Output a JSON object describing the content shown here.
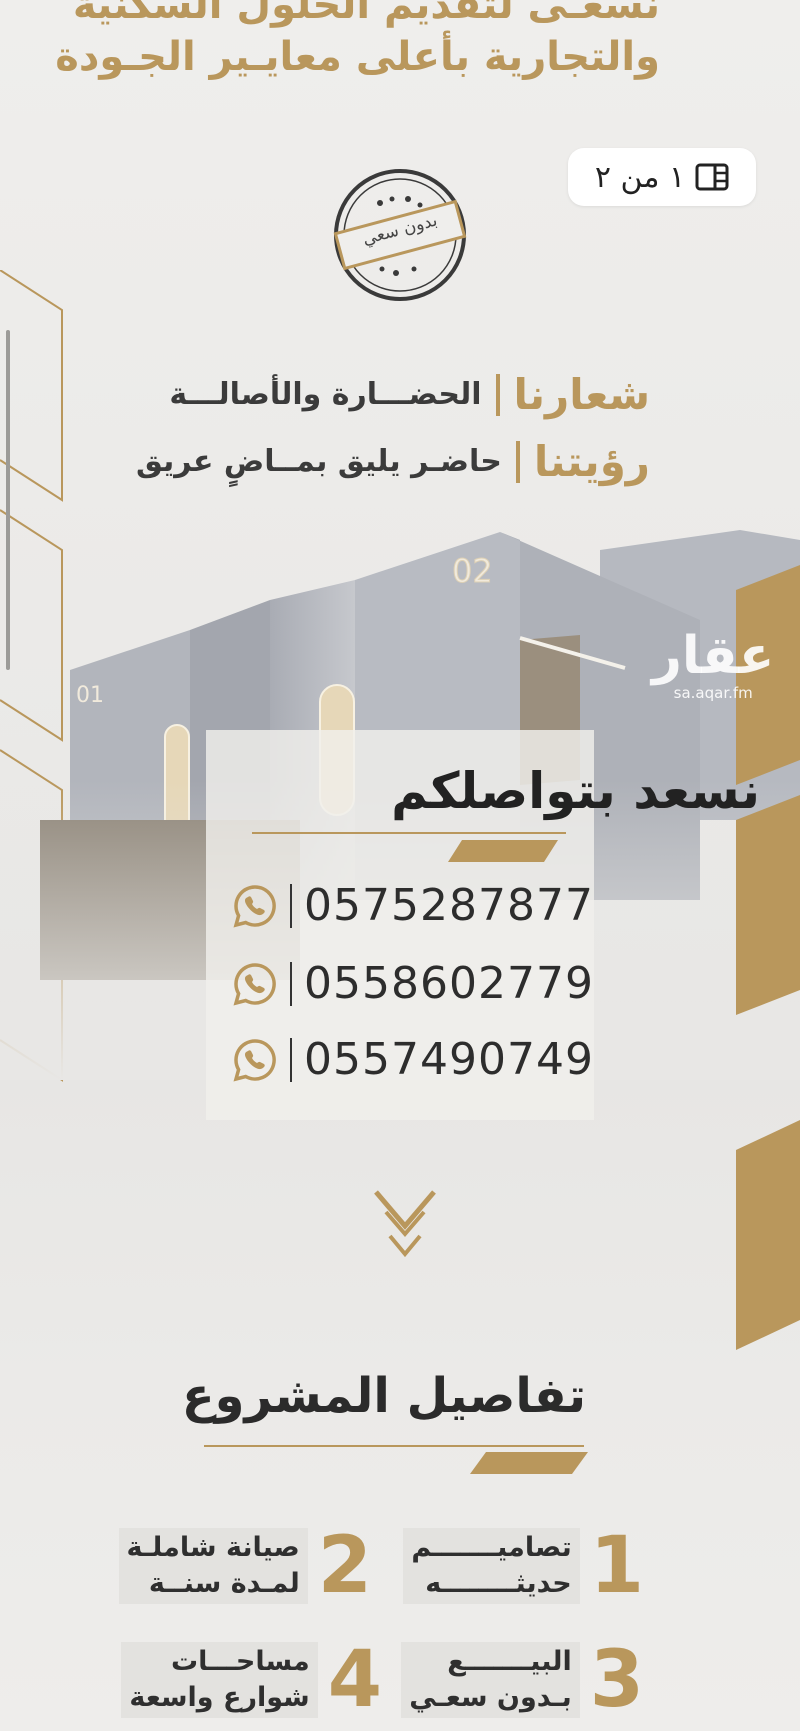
{
  "header": {
    "tagline_line1": "نسعـى لتقديم الحلول السكنية",
    "tagline_line2": "والتجارية بأعلى معايـير الجـودة"
  },
  "page_indicator": {
    "label": "١ من ٢",
    "icon": "gallery-icon"
  },
  "stamp": {
    "text": "بدون سعي"
  },
  "slogans": {
    "slogan_key": "شعارنا",
    "slogan_value": "الحضـــارة والأصالـــة",
    "vision_key": "رؤيتنا",
    "vision_value": "حاضـر يليق بمــاضٍ عريق"
  },
  "building": {
    "sign_left": "01",
    "sign_right": "02"
  },
  "watermark": {
    "logo": "عقار",
    "url": "sa.aqar.fm"
  },
  "contact": {
    "title": "نسعد بتواصلكم",
    "phones": [
      "0575287877",
      "0558602779",
      "0557490749"
    ],
    "icon": "whatsapp-icon"
  },
  "details": {
    "title": "تفاصيل المشروع",
    "features": [
      {
        "number": "1",
        "line1": "تصاميـــــــم",
        "line2": "حديثــــــــه"
      },
      {
        "number": "2",
        "line1": "صيانة شاملـة",
        "line2": "لمـدة سنــة"
      },
      {
        "number": "3",
        "line1": "البيـــــــع",
        "line2": "بـدون سعـي"
      },
      {
        "number": "4",
        "line1": "مساحـــات",
        "line2": "شوارع واسعة"
      }
    ]
  },
  "colors": {
    "gold": "#b9975c",
    "text_dark": "#2d2d2d",
    "background": "#ecebe9"
  }
}
